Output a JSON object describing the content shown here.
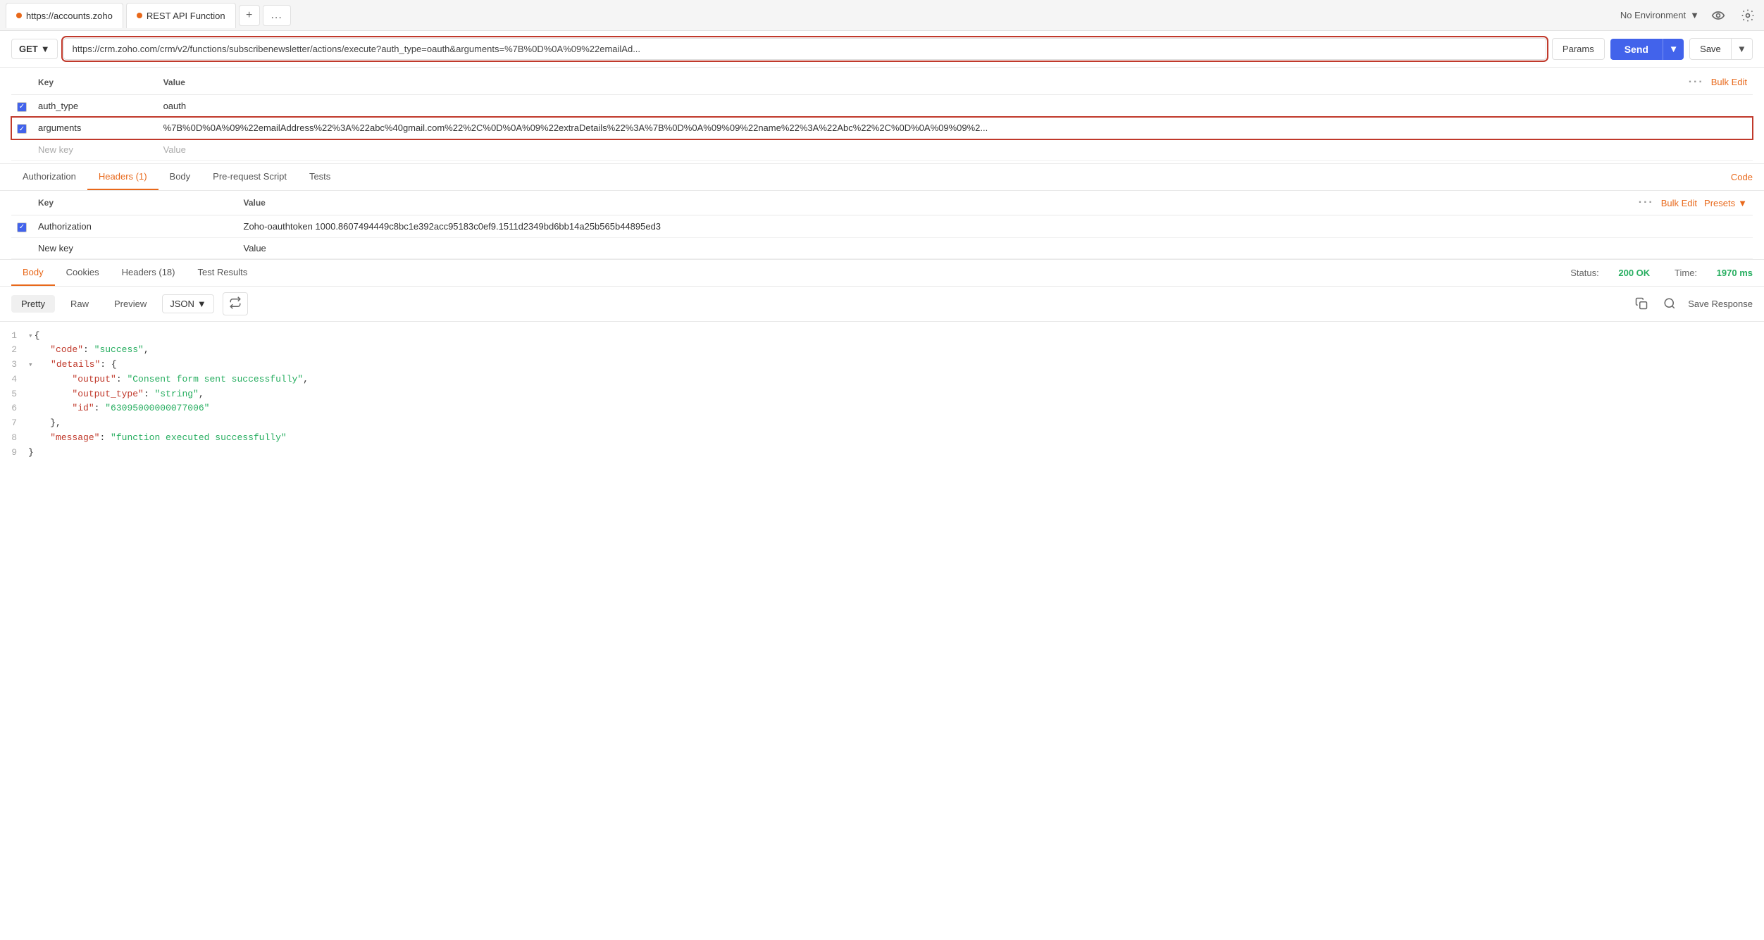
{
  "tabBar": {
    "tabs": [
      {
        "label": "https://accounts.zoho",
        "dotColor": "orange"
      },
      {
        "label": "REST API Function",
        "dotColor": "orange"
      }
    ],
    "addBtnLabel": "+",
    "moreBtnLabel": "...",
    "env": {
      "label": "No Environment",
      "chevron": "▼"
    }
  },
  "requestBar": {
    "method": "GET",
    "url": "https://crm.zoho.com/crm/v2/functions/subscribenewsletter/actions/execute?auth_type=oauth&arguments=%7B%0D%0A%09%22emailAd...",
    "paramsBtn": "Params",
    "sendBtn": "Send",
    "saveBtn": "Save"
  },
  "paramsTable": {
    "headers": [
      "Key",
      "Value"
    ],
    "bulkEditLabel": "Bulk Edit",
    "rows": [
      {
        "checked": true,
        "key": "auth_type",
        "value": "oauth",
        "highlighted": false
      },
      {
        "checked": true,
        "key": "arguments",
        "value": "%7B%0D%0A%09%22emailAddress%22%3A%22abc%40gmail.com%22%2C%0D%0A%09%22extraDetails%22%3A%7B%0D%0A%09%09%22name%22%3A%22Abc%22%2C%0D%0A%09%09%2...",
        "highlighted": true
      }
    ],
    "newKeyPlaceholder": "New key",
    "newValuePlaceholder": "Value"
  },
  "reqTabs": {
    "tabs": [
      {
        "label": "Authorization",
        "active": false
      },
      {
        "label": "Headers (1)",
        "active": true
      },
      {
        "label": "Body",
        "active": false
      },
      {
        "label": "Pre-request Script",
        "active": false
      },
      {
        "label": "Tests",
        "active": false
      }
    ],
    "rightAction": "Code"
  },
  "headersTable": {
    "headers": [
      "Key",
      "Value"
    ],
    "bulkEditLabel": "Bulk Edit",
    "presetsLabel": "Presets",
    "rows": [
      {
        "checked": true,
        "key": "Authorization",
        "value": "Zoho-oauthtoken 1000.8607494449c8bc1e392acc95183c0ef9.1511d2349bd6bb14a25b565b44895ed3"
      }
    ],
    "newKeyPlaceholder": "New key",
    "newValuePlaceholder": "Value"
  },
  "responseTabs": {
    "tabs": [
      {
        "label": "Body",
        "active": true
      },
      {
        "label": "Cookies",
        "active": false
      },
      {
        "label": "Headers (18)",
        "active": false
      },
      {
        "label": "Test Results",
        "active": false
      }
    ],
    "status": {
      "label": "Status:",
      "value": "200 OK"
    },
    "time": {
      "label": "Time:",
      "value": "1970 ms"
    }
  },
  "responseBody": {
    "tabs": [
      {
        "label": "Pretty",
        "active": true
      },
      {
        "label": "Raw",
        "active": false
      },
      {
        "label": "Preview",
        "active": false
      }
    ],
    "format": "JSON",
    "saveResponseLabel": "Save Response",
    "lines": [
      {
        "num": "1",
        "content": "{",
        "type": "brace",
        "arrow": "▾"
      },
      {
        "num": "2",
        "content": "    \"code\": \"success\",",
        "type": "mixed"
      },
      {
        "num": "3",
        "content": "    \"details\": {",
        "type": "mixed",
        "arrow": "▾"
      },
      {
        "num": "4",
        "content": "        \"output\": \"Consent form sent successfully\",",
        "type": "mixed"
      },
      {
        "num": "5",
        "content": "        \"output_type\": \"string\",",
        "type": "mixed"
      },
      {
        "num": "6",
        "content": "        \"id\": \"63095000000077006\"",
        "type": "mixed"
      },
      {
        "num": "7",
        "content": "    },",
        "type": "mixed"
      },
      {
        "num": "8",
        "content": "    \"message\": \"function executed successfully\"",
        "type": "mixed"
      },
      {
        "num": "9",
        "content": "}",
        "type": "brace"
      }
    ]
  }
}
